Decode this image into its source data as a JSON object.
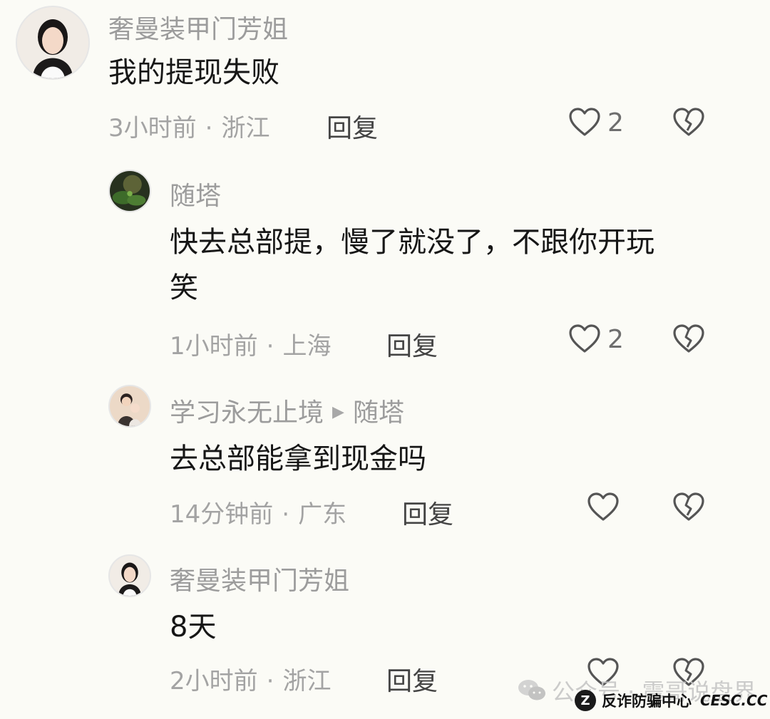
{
  "comments": [
    {
      "user": "奢曼装甲门芳姐",
      "text": [
        "我的提现失败"
      ],
      "time": "3小时前",
      "location": "浙江",
      "reply_label": "回复",
      "likes": "2",
      "avatar_icon": "woman-portrait"
    },
    {
      "user": "随塔",
      "text": [
        "快去总部提，慢了就没了，不跟你开玩",
        "笑"
      ],
      "time": "1小时前",
      "location": "上海",
      "reply_label": "回复",
      "likes": "2",
      "avatar_icon": "green-plant-photo"
    },
    {
      "user": "学习永无止境",
      "reply_to": "随塔",
      "text": [
        "去总部能拿到现金吗"
      ],
      "time": "14分钟前",
      "location": "广东",
      "reply_label": "回复",
      "likes": "",
      "avatar_icon": "couple-cartoon"
    },
    {
      "user": "奢曼装甲门芳姐",
      "text": [
        "8天"
      ],
      "time": "2小时前",
      "location": "浙江",
      "reply_label": "回复",
      "likes": "",
      "avatar_icon": "woman-portrait"
    }
  ],
  "meta_separator": "·",
  "reply_arrow": "▶",
  "watermark": {
    "text": "公众号 · 震哥说盘界",
    "icon": "wechat-icon"
  },
  "badge": {
    "logo": "Z",
    "text": "反诈防骗中心",
    "site": "CESC.CC"
  },
  "colors": {
    "background": "#fbfbf6",
    "username": "#9c9c9c",
    "body_text": "#161616",
    "meta": "#a3a3a3",
    "icon_stroke": "#555555"
  }
}
